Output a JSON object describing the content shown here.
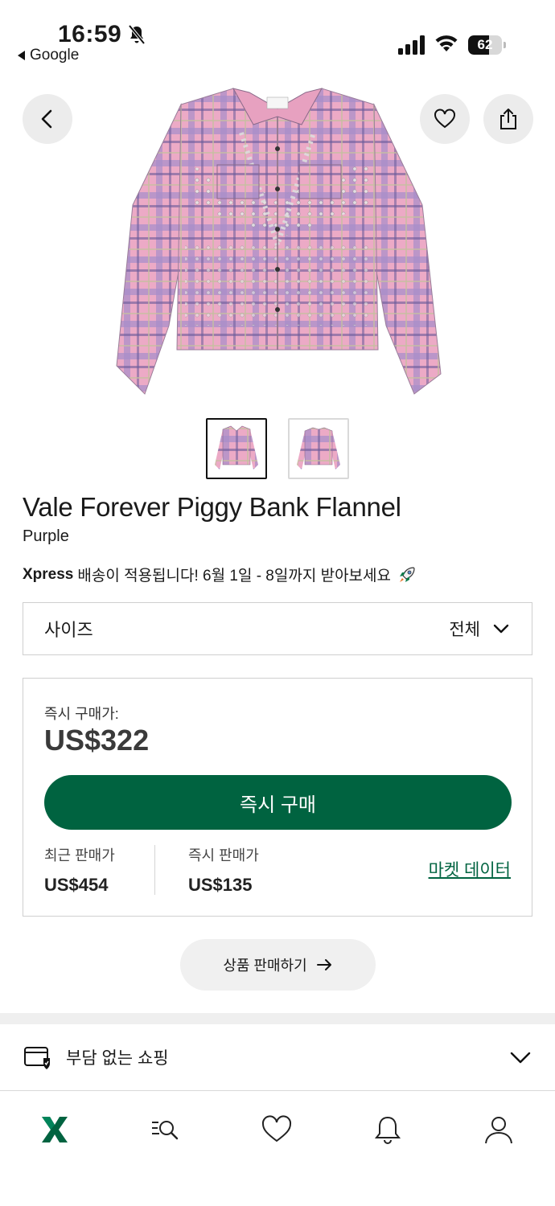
{
  "status_bar": {
    "time": "16:59",
    "back_app": "Google",
    "battery": "62",
    "battery_level": 0.62
  },
  "product": {
    "name": "Vale Forever Piggy Bank Flannel",
    "color": "Purple",
    "shipping_brand": "Xpress",
    "shipping_text": "배송이 적용됩니다! 6월 1일 - 8일까지 받아보세요"
  },
  "size_selector": {
    "label": "사이즈",
    "value": "전체"
  },
  "buy_box": {
    "buy_now_label": "즉시 구매가:",
    "buy_now_price": "US$322",
    "buy_button": "즉시 구매",
    "last_sale_label": "최근 판매가",
    "last_sale_value": "US$454",
    "sell_now_label": "즉시 판매가",
    "sell_now_value": "US$135",
    "market_data_link": "마켓 데이터"
  },
  "sell_button": "상품 판매하기",
  "worry_free": "부담 없는 쇼핑",
  "colors": {
    "brand_green": "#006340",
    "plaid_pink": "#e9a0c0",
    "plaid_purple": "#7a5fa8"
  },
  "icons": {
    "back": "chevron-left-icon",
    "favorite": "heart-icon",
    "share": "share-icon",
    "nav": [
      "home-logo-icon",
      "search-icon",
      "heart-icon",
      "bell-icon",
      "profile-icon"
    ]
  }
}
